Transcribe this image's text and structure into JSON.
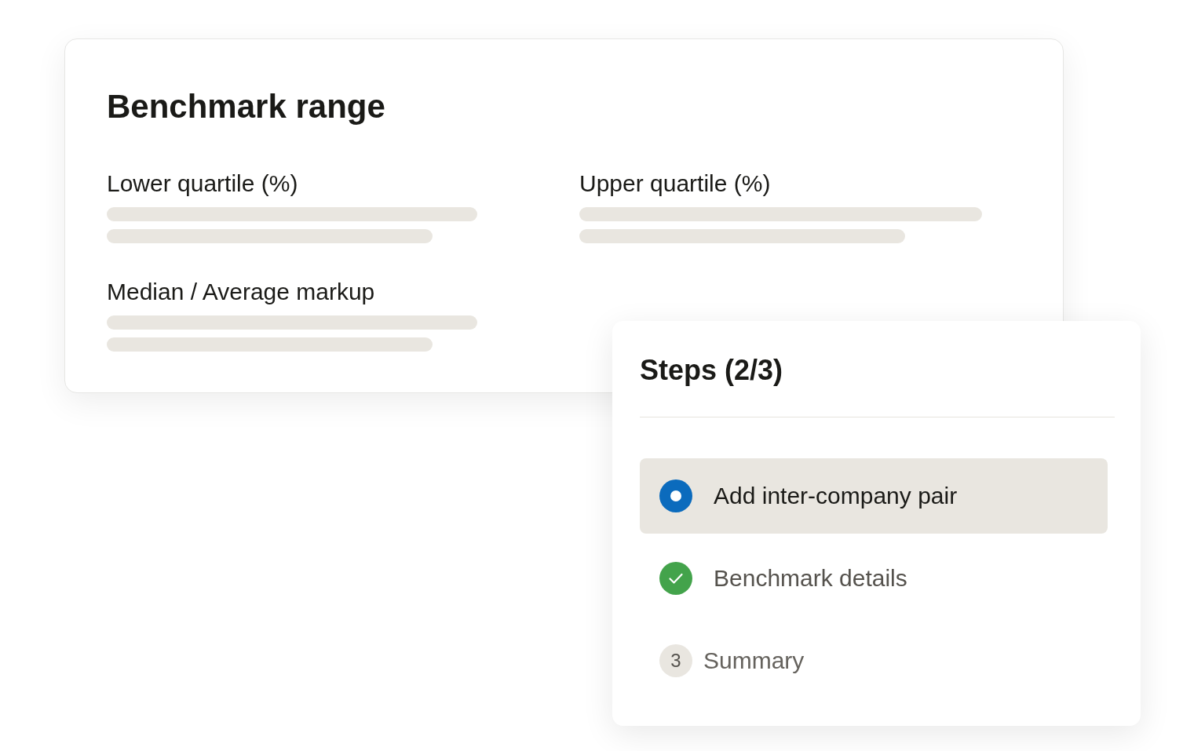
{
  "benchmark_card": {
    "title": "Benchmark range",
    "fields": [
      {
        "label": "Lower quartile (%)"
      },
      {
        "label": "Upper quartile (%)"
      },
      {
        "label": "Median / Average markup"
      }
    ]
  },
  "steps_card": {
    "title": "Steps (2/3)",
    "steps": [
      {
        "label": "Add inter-company pair",
        "kind": "current",
        "selected": true
      },
      {
        "label": "Benchmark details",
        "kind": "done",
        "selected": false
      },
      {
        "label": "Summary",
        "kind": "pending",
        "number": "3",
        "selected": false
      }
    ]
  }
}
